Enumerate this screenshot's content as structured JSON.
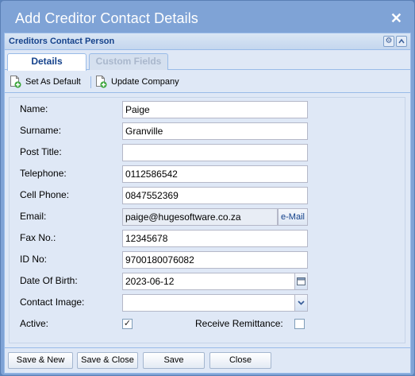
{
  "window": {
    "title": "Add Creditor Contact Details"
  },
  "panel": {
    "title": "Creditors Contact Person"
  },
  "tabs": [
    {
      "label": "Details"
    },
    {
      "label": "Custom Fields"
    }
  ],
  "toolbar": {
    "set_default_label": "Set As Default",
    "update_company_label": "Update Company"
  },
  "form": {
    "name": {
      "label": "Name:",
      "value": "Paige"
    },
    "surname": {
      "label": "Surname:",
      "value": "Granville"
    },
    "post_title": {
      "label": "Post Title:",
      "value": ""
    },
    "telephone": {
      "label": "Telephone:",
      "value": "0112586542"
    },
    "cell_phone": {
      "label": "Cell Phone:",
      "value": "0847552369"
    },
    "email": {
      "label": "Email:",
      "value": "paige@hugesoftware.co.za",
      "button_label": "e-Mail"
    },
    "fax": {
      "label": "Fax No.:",
      "value": "12345678"
    },
    "id_no": {
      "label": "ID No:",
      "value": "9700180076082"
    },
    "dob": {
      "label": "Date Of Birth:",
      "value": "2023-06-12"
    },
    "contact_image": {
      "label": "Contact Image:",
      "value": ""
    },
    "active": {
      "label": "Active:",
      "checked": true
    },
    "receive_remittance": {
      "label": "Receive Remittance:",
      "checked": false
    }
  },
  "footer": {
    "save_new_label": "Save & New",
    "save_close_label": "Save & Close",
    "save_label": "Save",
    "close_label": "Close"
  },
  "icons": {
    "close": "close-icon",
    "gear": "gear-icon",
    "collapse": "chevron-up-icon",
    "set_default": "page-add-icon",
    "update_company": "page-add-icon",
    "calendar": "calendar-icon",
    "dropdown": "chevron-down-icon",
    "checkmark": "check-icon"
  },
  "colors": {
    "window_bg": "#7fa3d6",
    "panel_bg": "#dfe8f6",
    "header_text": "#15428b",
    "tab_inactive_text": "#a9b7cc"
  }
}
